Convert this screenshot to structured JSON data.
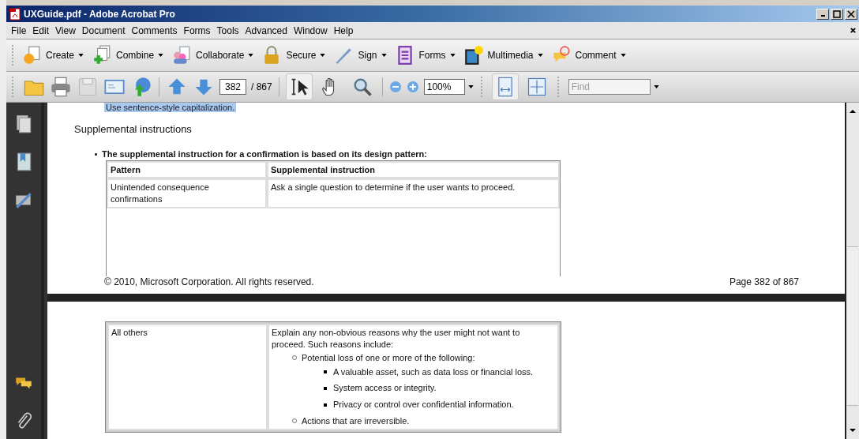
{
  "window": {
    "title": "UXGuide.pdf - Adobe Acrobat Pro"
  },
  "menu": [
    "File",
    "Edit",
    "View",
    "Document",
    "Comments",
    "Forms",
    "Tools",
    "Advanced",
    "Window",
    "Help"
  ],
  "task_buttons": [
    {
      "label": "Create",
      "kind": "create"
    },
    {
      "label": "Combine",
      "kind": "combine"
    },
    {
      "label": "Collaborate",
      "kind": "collaborate"
    },
    {
      "label": "Secure",
      "kind": "secure"
    },
    {
      "label": "Sign",
      "kind": "sign"
    },
    {
      "label": "Forms",
      "kind": "forms"
    },
    {
      "label": "Multimedia",
      "kind": "multimedia"
    },
    {
      "label": "Comment",
      "kind": "comment"
    }
  ],
  "toolbar": {
    "page": "382",
    "page_total": "/ 867",
    "zoom": "100%",
    "find_placeholder": "Find",
    "tools": [
      {
        "kind": "select",
        "selected": true
      },
      {
        "kind": "hand",
        "selected": false
      },
      {
        "kind": "marquee",
        "selected": false
      }
    ],
    "views": [
      {
        "kind": "fit-width",
        "selected": true
      },
      {
        "kind": "full-screen",
        "selected": false
      }
    ]
  },
  "page_one": {
    "cut_line": "Use sentence-style capitalization.",
    "heading": "Supplemental instructions",
    "intro": "The supplemental instruction for a confirmation is based on its design pattern:",
    "columns": [
      "Pattern",
      "Supplemental instruction"
    ],
    "row": [
      "Unintended consequence confirmations",
      "Ask a single question to determine if the user wants to proceed."
    ],
    "copyright": "© 2010, Microsoft Corporation. All rights reserved.",
    "page_label": "Page 382 of 867"
  },
  "page_two": {
    "pattern": "All others",
    "text": "Explain any non-obvious reasons why the user might not want to proceed. Such reasons include:",
    "items": [
      {
        "text": "Potential loss of one or more of the following:",
        "children": [
          {
            "text": "A valuable asset, such as data loss or financial loss."
          },
          {
            "text": "System access or integrity."
          },
          {
            "text": "Privacy or control over confidential information."
          }
        ]
      },
      {
        "text": "Actions that are irreversible."
      }
    ]
  }
}
